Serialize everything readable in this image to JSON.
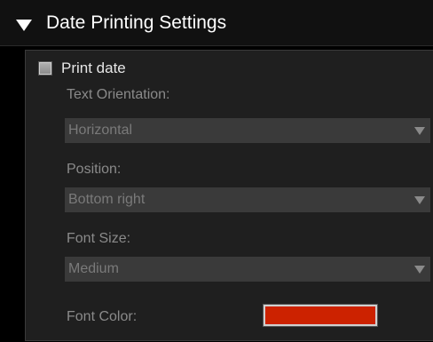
{
  "header": {
    "title": "Date Printing Settings",
    "collapse_icon": "triangle-down-icon"
  },
  "print_date": {
    "label": "Print date",
    "checked": false,
    "enabled": false
  },
  "text_orientation": {
    "label": "Text Orientation:",
    "value": "Horizontal"
  },
  "position": {
    "label": "Position:",
    "value": "Bottom right"
  },
  "font_size": {
    "label": "Font Size:",
    "value": "Medium"
  },
  "font_color": {
    "label": "Font Color:",
    "color": "#cc2200"
  },
  "colors": {
    "panel_bg": "#1f1f1f",
    "header_bg": "#111111",
    "dropdown_bg": "#3a3a3a",
    "disabled_text": "#8a8a8a"
  }
}
